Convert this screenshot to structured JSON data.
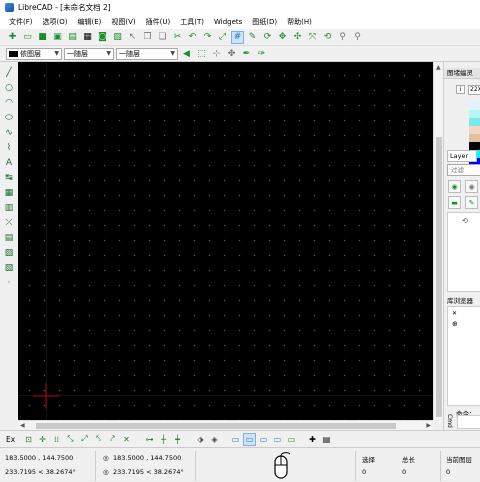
{
  "window": {
    "title": "LibreCAD - [未命名文档 2]"
  },
  "menu": [
    "文件(F)",
    "选项(O)",
    "编辑(E)",
    "视图(V)",
    "插件(U)",
    "工具(T)",
    "Widgets",
    "图纸(D)",
    "帮助(H)"
  ],
  "toolbar": {
    "icons": [
      "new-icon",
      "open-icon",
      "save-icon",
      "save-as-icon",
      "save-all-icon",
      "print-icon",
      "print-preview-icon",
      "export-icon",
      "pointer-icon",
      "copy-icon",
      "paste-icon",
      "cut-icon",
      "undo-icon",
      "redo-icon",
      "zoom-window-icon",
      "grid-icon",
      "draft-icon",
      "zoom-redraw-icon",
      "zoom-in-icon",
      "zoom-out-icon",
      "zoom-auto-icon",
      "zoom-previous-icon",
      "zoom-pan-icon",
      "zoom-selection-icon"
    ],
    "selected": "grid-icon"
  },
  "pen": {
    "color_value": "依图层",
    "linetype_value": "一随层",
    "width_value": "一随层"
  },
  "dock": {
    "palette_title": "图堵蝠灵",
    "palette_field": "22X",
    "layer_tab": "Layer",
    "filter_placeholder": "过滤",
    "library_title": "库浏览器",
    "command_label": "命令：",
    "command_side": "Cmd",
    "palette_colors": [
      "#dff3ff",
      "#b8f5f5",
      "#7fe7ea",
      "#f0d8c0",
      "#e0c0a0",
      "#000000",
      "#00ffff",
      "#0000ff"
    ]
  },
  "snap": {
    "ex_label": "Ex"
  },
  "status": {
    "abs_coords": "183.5000 , 144.7500",
    "polar_coords": "233.7195 < 38.2674°",
    "rel_coords": "183.5000 , 144.7500",
    "rel_polar": "233.7195 < 38.2674°",
    "selected_label": "选择",
    "selected_value": "0",
    "total_label": "总长",
    "total_value": "0",
    "layer_label": "当前图层",
    "layer_value": "0"
  },
  "colors": {
    "canvas": "#000000",
    "grid_dot": "#5a5a5a",
    "crosshair": "#c00000",
    "accent_green": "#1a8f2a"
  }
}
